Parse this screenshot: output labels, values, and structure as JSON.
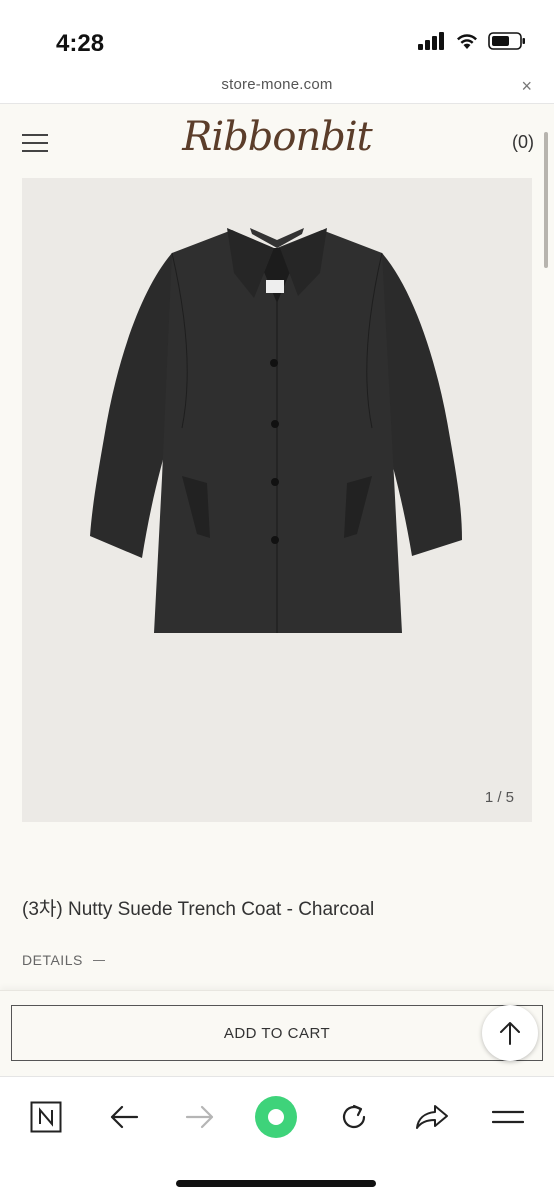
{
  "status_bar": {
    "time": "4:28"
  },
  "browser": {
    "url": "store-mone.com",
    "close_symbol": "×"
  },
  "header": {
    "logo": "Ribbonbit",
    "cart_count": "(0)"
  },
  "product": {
    "image_counter": "1 / 5",
    "title": "(3차) Nutty Suede Trench Coat - Charcoal",
    "details_label": "DETAILS"
  },
  "actions": {
    "add_to_cart_label": "ADD TO CART"
  },
  "toolbar": {
    "icons": [
      "naver-n-icon",
      "back-arrow-icon",
      "forward-arrow-icon",
      "green-dot-icon",
      "reload-icon",
      "share-icon",
      "menu-icon"
    ],
    "accent_green": "#3ed37a"
  },
  "colors": {
    "background": "#faf9f4",
    "image_background": "#eceae6",
    "coat": "#2b2b2b",
    "logo": "#5b3d2a"
  }
}
